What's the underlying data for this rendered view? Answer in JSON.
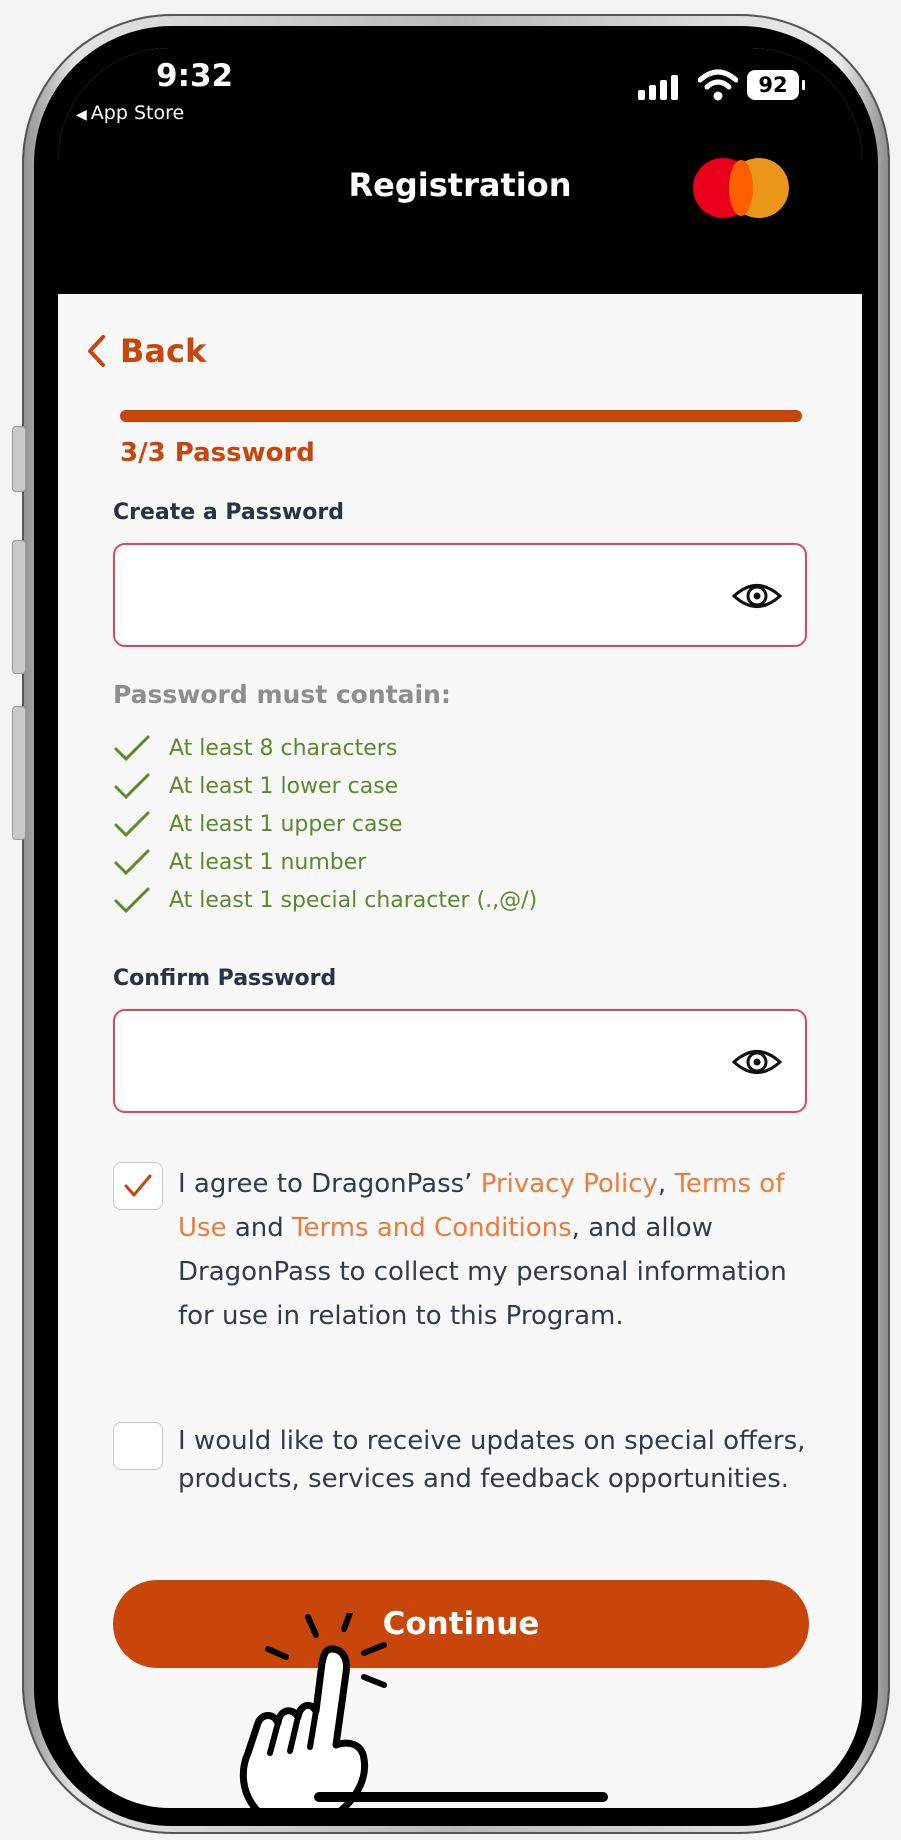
{
  "status_bar": {
    "time": "9:32",
    "back_app": "App Store",
    "battery": "92"
  },
  "header": {
    "title": "Registration"
  },
  "nav": {
    "back_label": "Back"
  },
  "progress": {
    "step_label": "3/3 Password",
    "fraction": 1.0
  },
  "password": {
    "label": "Create a Password",
    "value": "",
    "requirements_title": "Password must contain:",
    "requirements": [
      "At least 8 characters",
      "At least 1 lower case",
      "At least 1 upper case",
      "At least 1 number",
      "At least 1 special character (.,@/)"
    ]
  },
  "confirm": {
    "label": "Confirm Password",
    "value": ""
  },
  "consent": {
    "checked": true,
    "text_1": "I agree to DragonPass’ ",
    "link_privacy": "Privacy Policy",
    "text_2": ", ",
    "link_terms_use": "Terms of Use",
    "text_3": " and ",
    "link_terms_conditions": "Terms and Conditions",
    "text_4": ", and allow DragonPass to collect my personal information for use in relation to this Program."
  },
  "marketing": {
    "checked": false,
    "text": "I would like to receive updates on special offers, products, services and feedback opportunities."
  },
  "continue_label": "Continue",
  "colors": {
    "accent": "#c9460b",
    "link": "#f07a3a",
    "success": "#5b8a2a",
    "error_border": "#e0455a"
  }
}
